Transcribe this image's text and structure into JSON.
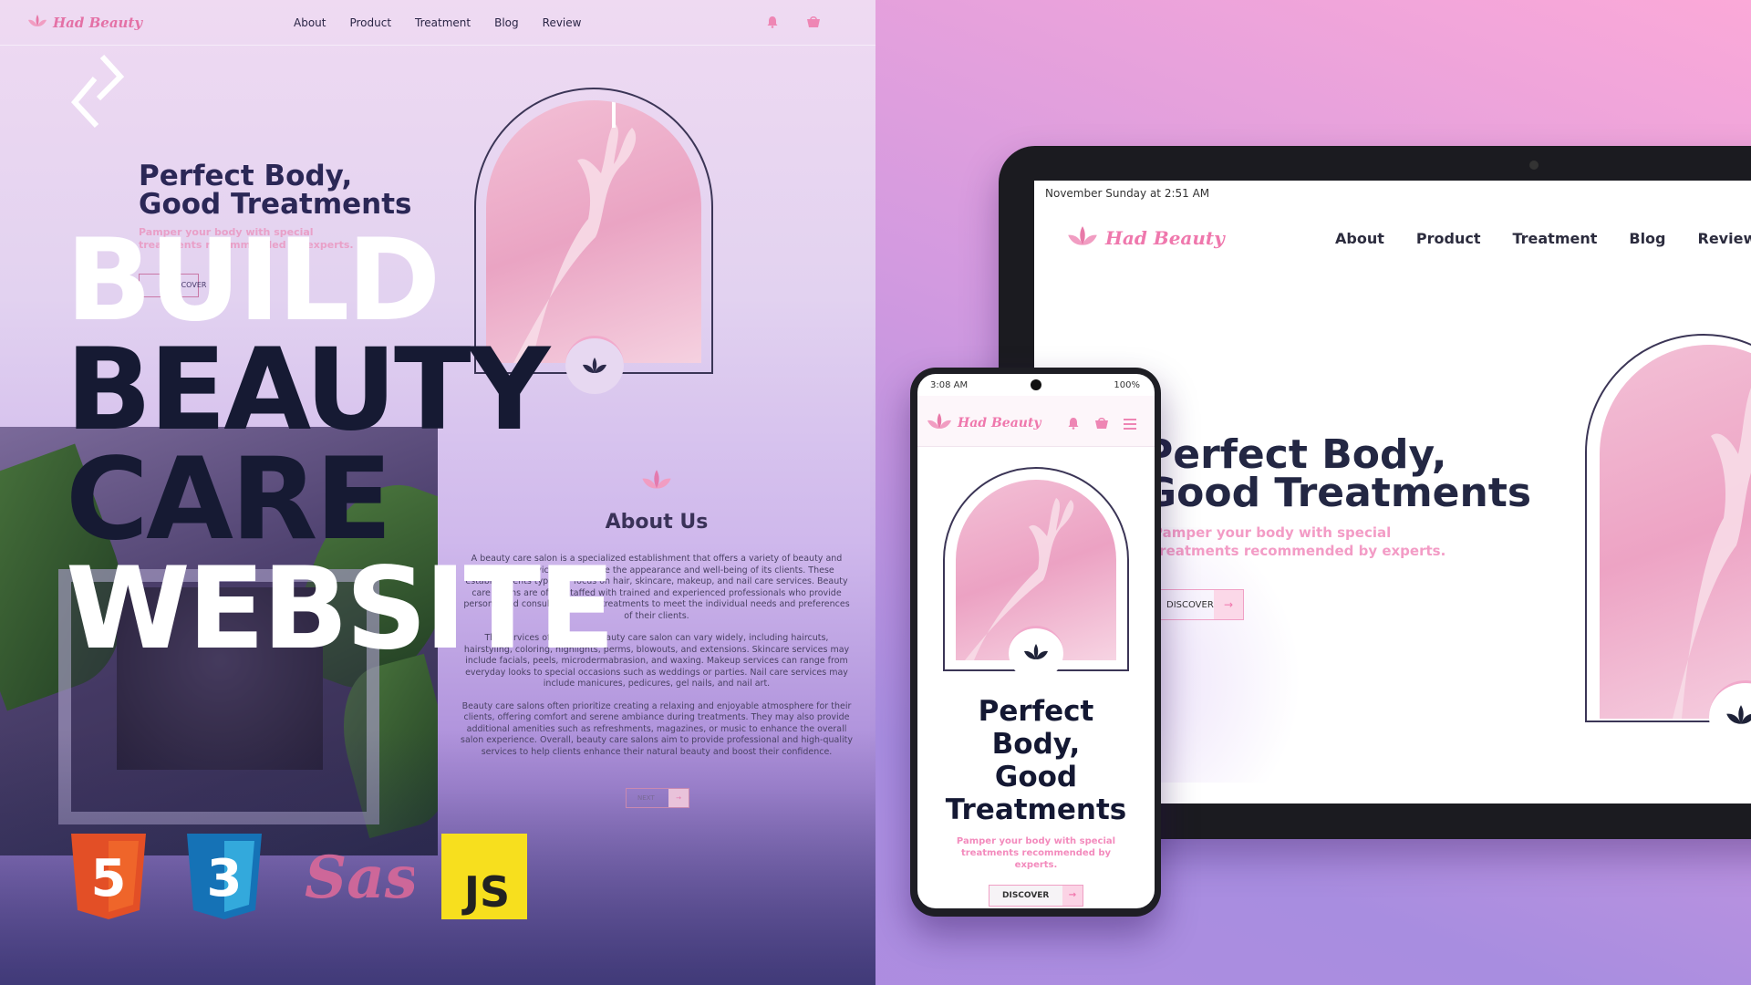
{
  "brand": {
    "name": "Had Beauty",
    "accent": "#ef78ad",
    "dark": "#141833"
  },
  "nav": {
    "items": [
      "About",
      "Product",
      "Treatment",
      "Blog",
      "Review"
    ]
  },
  "hero": {
    "title_line1": "Perfect Body,",
    "title_line2": "Good Treatments",
    "subtitle": "Pamper your body with special treatments recommended by experts.",
    "button": "DISCOVER"
  },
  "thumbnail_title": {
    "line1": "BUILD",
    "line2": "BEAUTY",
    "line3": "CARE",
    "line4": "WEBSITE"
  },
  "about": {
    "title": "About Us",
    "paragraphs": [
      "A beauty care salon is a specialized establishment that offers a variety of beauty and grooming services to enhance the appearance and well-being of its clients. These establishments typically focus on hair, skincare, makeup, and nail care services. Beauty care salons are often staffed with trained and experienced professionals who provide personalized consultations and treatments to meet the individual needs and preferences of their clients.",
      "The services offered at a beauty care salon can vary widely, including haircuts, hairstyling, coloring, highlights, perms, blowouts, and extensions. Skincare services may include facials, peels, microdermabrasion, and waxing. Makeup services can range from everyday looks to special occasions such as weddings or parties. Nail care services may include manicures, pedicures, gel nails, and nail art.",
      "Beauty care salons often prioritize creating a relaxing and enjoyable atmosphere for their clients, offering comfort and serene ambiance during treatments. They may also provide additional amenities such as refreshments, magazines, or music to enhance the overall salon experience. Overall, beauty care salons aim to provide professional and high-quality services to help clients enhance their natural beauty and boost their confidence."
    ],
    "next_button": "NEXT"
  },
  "tech_logos": [
    "HTML5",
    "CSS3",
    "Sass",
    "JS"
  ],
  "tablet": {
    "status": "November Sunday at 2:51 AM"
  },
  "phone": {
    "status_left": "3:08 AM",
    "status_right": "100%",
    "title_line1": "Perfect",
    "title_line2": "Body,",
    "title_line3": "Good",
    "title_line4": "Treatments",
    "subtitle": "Pamper your body with special treatments recommended by experts.",
    "button": "DISCOVER"
  },
  "icons": {
    "logo": "lotus-icon",
    "bell": "bell-icon",
    "cart": "cart-icon",
    "menu": "menu-icon",
    "arrow": "arrow-right-icon"
  }
}
